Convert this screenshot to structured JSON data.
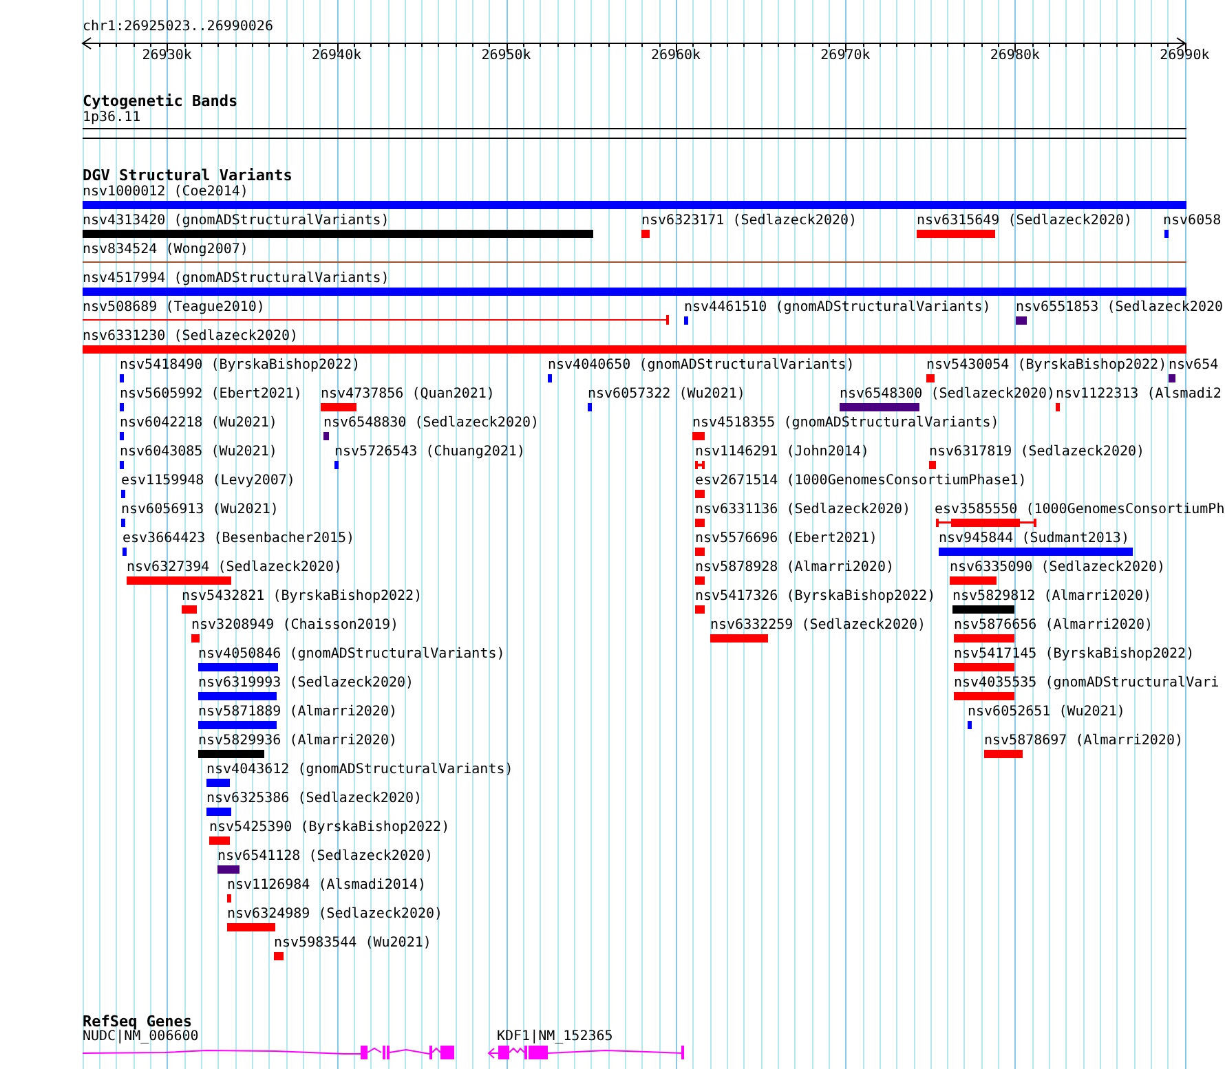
{
  "ruler": {
    "location": "chr1:26925023..26990026",
    "ticks": [
      "26930k",
      "26940k",
      "26950k",
      "26960k",
      "26970k",
      "26980k",
      "26990k"
    ]
  },
  "cytogenetic_bands": {
    "title": "Cytogenetic Bands",
    "band": "1p36.11"
  },
  "dgv": {
    "title": "DGV Structural Variants",
    "features": [
      {
        "label": "nsv1000012 (Coe2014)",
        "color": "#0000ff",
        "kind": "bar"
      },
      {
        "label": "nsv4313420 (gnomADStructuralVariants)",
        "color": "#000000",
        "kind": "bar"
      },
      {
        "label": "nsv6323171 (Sedlazeck2020)",
        "color": "#ff0000",
        "kind": "bar"
      },
      {
        "label": "nsv6315649 (Sedlazeck2020)",
        "color": "#ff0000",
        "kind": "bar"
      },
      {
        "label": "nsv6058",
        "color": "#0000ff",
        "kind": "bar"
      },
      {
        "label": "nsv834524 (Wong2007)",
        "color": "#a0522d",
        "kind": "line"
      },
      {
        "label": "nsv4517994 (gnomADStructuralVariants)",
        "color": "#0000ff",
        "kind": "bar"
      },
      {
        "label": "nsv508689 (Teague2010)",
        "color": "#ff0000",
        "kind": "line"
      },
      {
        "label": "nsv4461510 (gnomADStructuralVariants)",
        "color": "#0000ff",
        "kind": "bar"
      },
      {
        "label": "nsv6551853 (Sedlazeck2020",
        "color": "#4b0082",
        "kind": "bar"
      },
      {
        "label": "nsv6331230 (Sedlazeck2020)",
        "color": "#ff0000",
        "kind": "bar"
      },
      {
        "label": "nsv5418490 (ByrskaBishop2022)",
        "color": "#0000ff",
        "kind": "bar"
      },
      {
        "label": "nsv4040650 (gnomADStructuralVariants)",
        "color": "#0000ff",
        "kind": "bar"
      },
      {
        "label": "nsv5430054 (ByrskaBishop2022)",
        "color": "#ff0000",
        "kind": "bar"
      },
      {
        "label": "nsv654",
        "color": "#4b0082",
        "kind": "bar"
      },
      {
        "label": "nsv5605992 (Ebert2021)",
        "color": "#0000ff",
        "kind": "bar"
      },
      {
        "label": "nsv4737856 (Quan2021)",
        "color": "#ff0000",
        "kind": "bar"
      },
      {
        "label": "nsv6057322 (Wu2021)",
        "color": "#0000ff",
        "kind": "bar"
      },
      {
        "label": "nsv6548300 (Sedlazeck2020)",
        "color": "#4b0082",
        "kind": "bar"
      },
      {
        "label": "nsv1122313 (Alsmadi2",
        "color": "#ff0000",
        "kind": "bar"
      },
      {
        "label": "nsv6042218 (Wu2021)",
        "color": "#0000ff",
        "kind": "bar"
      },
      {
        "label": "nsv6548830 (Sedlazeck2020)",
        "color": "#4b0082",
        "kind": "bar"
      },
      {
        "label": "nsv4518355 (gnomADStructuralVariants)",
        "color": "#ff0000",
        "kind": "bar"
      },
      {
        "label": "nsv6043085 (Wu2021)",
        "color": "#0000ff",
        "kind": "bar"
      },
      {
        "label": "nsv5726543 (Chuang2021)",
        "color": "#0000ff",
        "kind": "bar"
      },
      {
        "label": "nsv1146291 (John2014)",
        "color": "#ff0000",
        "kind": "paired"
      },
      {
        "label": "nsv6317819 (Sedlazeck2020)",
        "color": "#ff0000",
        "kind": "bar"
      },
      {
        "label": "esv1159948 (Levy2007)",
        "color": "#0000ff",
        "kind": "bar"
      },
      {
        "label": "esv2671514 (1000GenomesConsortiumPhase1)",
        "color": "#ff0000",
        "kind": "bar"
      },
      {
        "label": "nsv6056913 (Wu2021)",
        "color": "#0000ff",
        "kind": "bar"
      },
      {
        "label": "nsv6331136 (Sedlazeck2020)",
        "color": "#ff0000",
        "kind": "bar"
      },
      {
        "label": "esv3585550 (1000GenomesConsortiumPh",
        "color": "#ff0000",
        "kind": "whisker"
      },
      {
        "label": "esv3664423 (Besenbacher2015)",
        "color": "#0000ff",
        "kind": "bar"
      },
      {
        "label": "nsv5576696 (Ebert2021)",
        "color": "#ff0000",
        "kind": "bar"
      },
      {
        "label": "nsv945844 (Sudmant2013)",
        "color": "#0000ff",
        "kind": "bar"
      },
      {
        "label": "nsv6327394 (Sedlazeck2020)",
        "color": "#ff0000",
        "kind": "bar"
      },
      {
        "label": "nsv5878928 (Almarri2020)",
        "color": "#ff0000",
        "kind": "bar"
      },
      {
        "label": "nsv6335090 (Sedlazeck2020)",
        "color": "#ff0000",
        "kind": "bar"
      },
      {
        "label": "nsv5432821 (ByrskaBishop2022)",
        "color": "#ff0000",
        "kind": "bar"
      },
      {
        "label": "nsv5417326 (ByrskaBishop2022)",
        "color": "#ff0000",
        "kind": "bar"
      },
      {
        "label": "nsv5829812 (Almarri2020)",
        "color": "#000000",
        "kind": "bar"
      },
      {
        "label": "nsv3208949 (Chaisson2019)",
        "color": "#ff0000",
        "kind": "bar"
      },
      {
        "label": "nsv6332259 (Sedlazeck2020)",
        "color": "#ff0000",
        "kind": "bar"
      },
      {
        "label": "nsv5876656 (Almarri2020)",
        "color": "#ff0000",
        "kind": "bar"
      },
      {
        "label": "nsv4050846 (gnomADStructuralVariants)",
        "color": "#0000ff",
        "kind": "bar"
      },
      {
        "label": "nsv5417145 (ByrskaBishop2022)",
        "color": "#ff0000",
        "kind": "bar"
      },
      {
        "label": "nsv6319993 (Sedlazeck2020)",
        "color": "#0000ff",
        "kind": "bar"
      },
      {
        "label": "nsv4035535 (gnomADStructuralVari",
        "color": "#ff0000",
        "kind": "bar"
      },
      {
        "label": "nsv5871889 (Almarri2020)",
        "color": "#0000ff",
        "kind": "bar"
      },
      {
        "label": "nsv6052651 (Wu2021)",
        "color": "#0000ff",
        "kind": "bar"
      },
      {
        "label": "nsv5829936 (Almarri2020)",
        "color": "#000000",
        "kind": "bar"
      },
      {
        "label": "nsv5878697 (Almarri2020)",
        "color": "#ff0000",
        "kind": "bar"
      },
      {
        "label": "nsv4043612 (gnomADStructuralVariants)",
        "color": "#0000ff",
        "kind": "bar"
      },
      {
        "label": "nsv6325386 (Sedlazeck2020)",
        "color": "#0000ff",
        "kind": "bar"
      },
      {
        "label": "nsv5425390 (ByrskaBishop2022)",
        "color": "#ff0000",
        "kind": "bar"
      },
      {
        "label": "nsv6541128 (Sedlazeck2020)",
        "color": "#4b0082",
        "kind": "bar"
      },
      {
        "label": "nsv1126984 (Alsmadi2014)",
        "color": "#ff0000",
        "kind": "bar"
      },
      {
        "label": "nsv6324989 (Sedlazeck2020)",
        "color": "#ff0000",
        "kind": "bar"
      },
      {
        "label": "nsv5983544 (Wu2021)",
        "color": "#ff0000",
        "kind": "bar"
      }
    ]
  },
  "refseq": {
    "title": "RefSeq Genes",
    "genes": [
      {
        "label": "NUDC|NM_006600"
      },
      {
        "label": "KDF1|NM_152365"
      }
    ]
  }
}
